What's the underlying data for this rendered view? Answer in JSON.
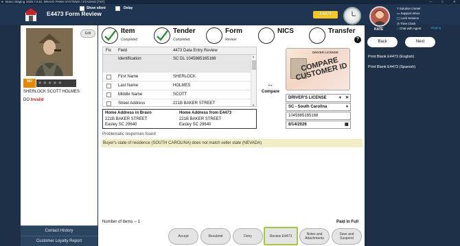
{
  "window": {
    "title": "Bravo Staging",
    "version": "2025.7.0.61",
    "company": "BRAVO PAWN SYSTEMS / STAGING [TST]"
  },
  "header": {
    "title": "E4473 Form Review",
    "show_silent_label": "Show silent",
    "delay_label": "Delay",
    "badge": "E4473",
    "user_name": "KATE",
    "staging_label": "Staging",
    "menu": [
      "Solution Center",
      "Support Inbox",
      "Lock Session",
      "Time Clock",
      "Chat with Agent"
    ]
  },
  "customer": {
    "edit_label": "Edit",
    "no_label": "NO",
    "name": "SHERLOCK SCOTT HOLMES",
    "dob_prefix": "DO",
    "dob_status": "Invalid",
    "rating_stars": 0
  },
  "sidebar": {
    "contact_history": "Contact History",
    "loyalty_report": "Customer Loyalty Report"
  },
  "steps": [
    {
      "label": "Item",
      "status": "Completed",
      "checked": true
    },
    {
      "label": "Tender",
      "status": "Completed",
      "checked": true
    },
    {
      "label": "Form",
      "status": "Review",
      "checked": false
    },
    {
      "label": "NICS",
      "status": "",
      "checked": false
    },
    {
      "label": "Transfer",
      "status": "",
      "checked": false
    }
  ],
  "table": {
    "headers": [
      "Fix",
      "Field",
      "4473 Data Entry Review"
    ],
    "rows": [
      {
        "field": "Identification",
        "value": "SC DL 1045885165168",
        "checkbox": false,
        "highlight": true
      },
      {
        "field": "",
        "value": "",
        "checkbox": false,
        "highlight": true
      },
      {
        "field": "First Name",
        "value": "SHERLOCK",
        "checkbox": true,
        "highlight": false
      },
      {
        "field": "Last Name",
        "value": "HOLMES",
        "checkbox": true,
        "highlight": false
      },
      {
        "field": "Middle Name",
        "value": "SCOTT",
        "checkbox": true,
        "highlight": false
      },
      {
        "field": "Street Address",
        "value": "221B BAKER STREET",
        "checkbox": true,
        "highlight": false
      }
    ]
  },
  "address": {
    "bravo_heading": "Home Address in Bravo",
    "bravo_lines": [
      "221B BAKER STREET",
      "Easley SC 29640"
    ],
    "e4473_heading": "Home Address from E4473",
    "e4473_lines": [
      "221B BAKER STREET",
      "Easley SC 29640"
    ]
  },
  "compare": {
    "label": "Compare",
    "arrow": "↔"
  },
  "id_card": {
    "header": "DRIVER LICENSE",
    "stamp": "COMPARE CUSTOMER ID",
    "type": "DRIVER'S LICENSE",
    "state": "SC - South Carolina",
    "number": "1045885165168",
    "expiry": "8/14/2026"
  },
  "problems": {
    "heading": "Problematic responses found",
    "message": "Buyer's state of residence (SOUTH CAROLINA) does not match seller state (NEVADA)"
  },
  "footer": {
    "items_count": "Number of Items -- 1",
    "paid_status": "Paid in Full"
  },
  "actions": [
    {
      "label": "Accept"
    },
    {
      "label": "Resubmit"
    },
    {
      "label": "Deny"
    },
    {
      "label": "Review E4473",
      "active": true
    },
    {
      "label": "Notes and Attachments"
    },
    {
      "label": "Save and Suspend"
    }
  ],
  "nav": {
    "back": "Back",
    "next": "Next"
  },
  "print_links": [
    "Print Blank E4473 (English)",
    "Print Blank E4473 (Spanish)"
  ],
  "colors": {
    "accent_green": "#2f8f3a",
    "highlight_yellow": "#f1edc4",
    "badge_yellow": "#f4c81f",
    "active_border": "#a6c93a"
  }
}
